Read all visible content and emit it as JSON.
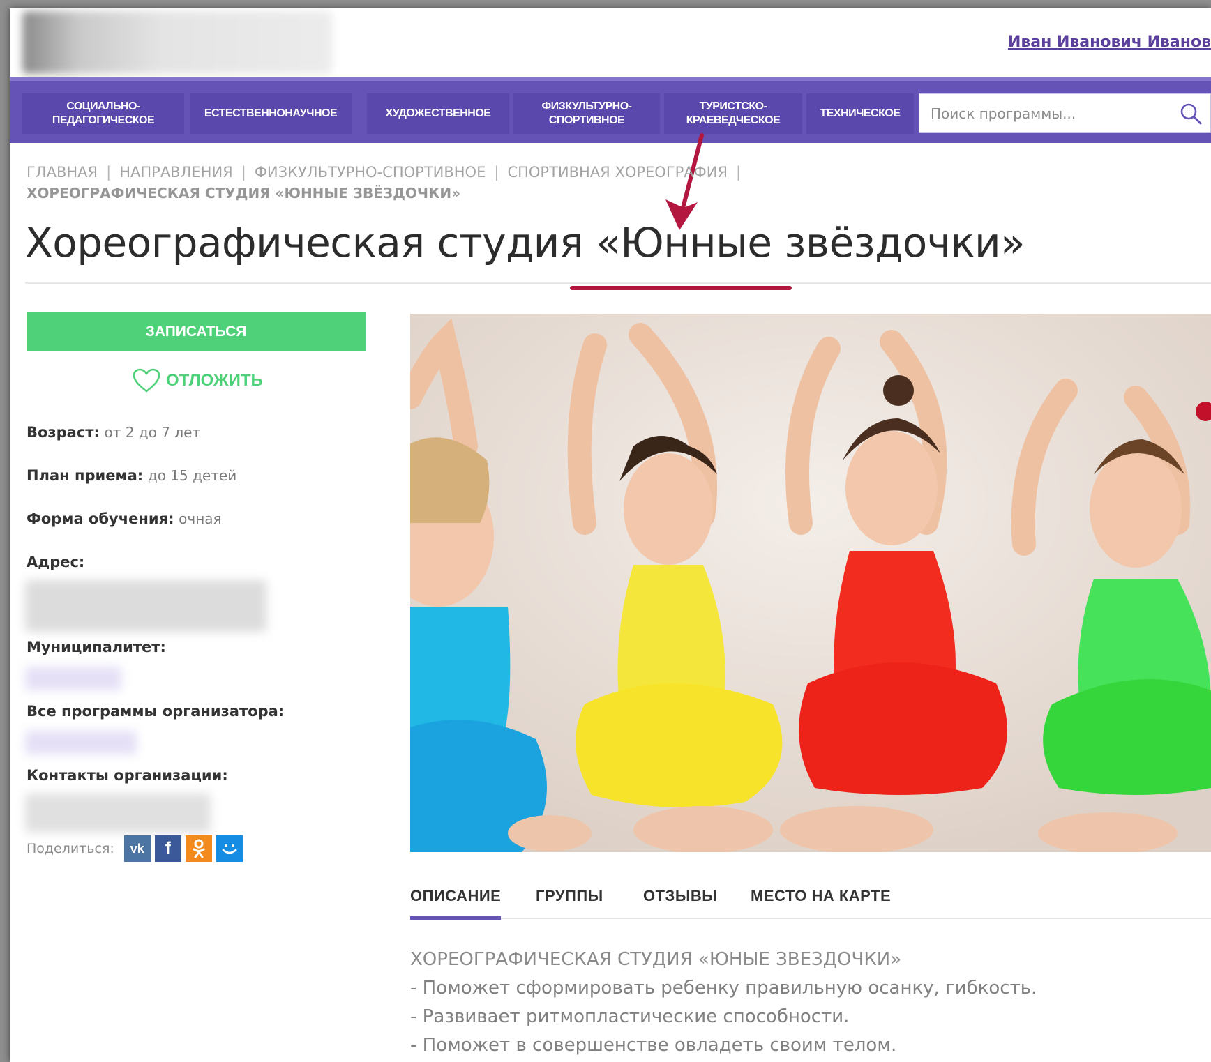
{
  "header": {
    "user_name": "Иван Иванович Иванов"
  },
  "nav": {
    "items": [
      {
        "label": "Социально-\nпедагогическое"
      },
      {
        "label": "Естественнонаучное"
      },
      {
        "label": "Художественное"
      },
      {
        "label": "Физкультурно-\nспортивное"
      },
      {
        "label": "Туристско-\nкраеведческое"
      },
      {
        "label": "Техническое"
      }
    ],
    "search_placeholder": "Поиск программы..."
  },
  "breadcrumb": {
    "items": [
      "Главная",
      "Направления",
      "Физкультурно-спортивное",
      "Спортивная хореография"
    ],
    "current": "Хореографическая студия «Юнные звёздочки»"
  },
  "page_title": "Хореографическая студия «Юнные звёздочки»",
  "sidebar": {
    "signup_label": "ЗАПИСАТЬСЯ",
    "postpone_label": "ОТЛОЖИТЬ",
    "age_label": "Возраст:",
    "age_value": "от 2 до 7 лет",
    "plan_label": "План приема:",
    "plan_value": "до 15 детей",
    "form_label": "Форма обучения:",
    "form_value": "очная",
    "address_label": "Адрес:",
    "municipality_label": "Муниципалитет:",
    "all_programs_label": "Все программы организатора:",
    "contacts_label": "Контакты организации:",
    "share_label": "Поделиться:",
    "share_icons": [
      "vk-icon",
      "facebook-icon",
      "odnoklassniki-icon",
      "moimir-icon"
    ]
  },
  "tabs": [
    {
      "label": "Описание",
      "active": true
    },
    {
      "label": "Группы"
    },
    {
      "label": "Отзывы"
    },
    {
      "label": "Место на карте"
    }
  ],
  "description": {
    "heading": "Хореографическая студия «Юные звездочки»",
    "lines": [
      "- Поможет сформировать ребенку правильную осанку, гибкость.",
      "- Развивает ритмопластические способности.",
      "- Поможет в совершенстве овладеть своим телом."
    ]
  },
  "colors": {
    "nav_bg": "#6553b6",
    "accent_green": "#4fd17a",
    "highlight_red": "#b3163f"
  }
}
